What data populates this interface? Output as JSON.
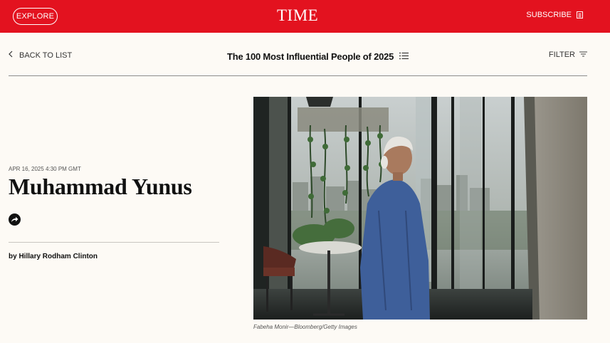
{
  "header": {
    "explore_label": "EXPLORE",
    "logo_text": "TIME",
    "subscribe_label": "SUBSCRIBE",
    "brand_color": "#e3121f"
  },
  "subnav": {
    "back_label": "BACK TO LIST",
    "list_title": "The 100 Most Influential People of 2025",
    "filter_label": "FILTER"
  },
  "article": {
    "dateline": "APR 16, 2025 4:30 PM GMT",
    "name": "Muhammad Yunus",
    "byline": "by Hillary Rodham Clinton"
  },
  "photo": {
    "credit": "Fabeha Monir—Bloomberg/Getty Images"
  },
  "icons": [
    "chevron-left-icon",
    "list-icon",
    "filter-icon",
    "subscribe-icon",
    "share-icon"
  ]
}
